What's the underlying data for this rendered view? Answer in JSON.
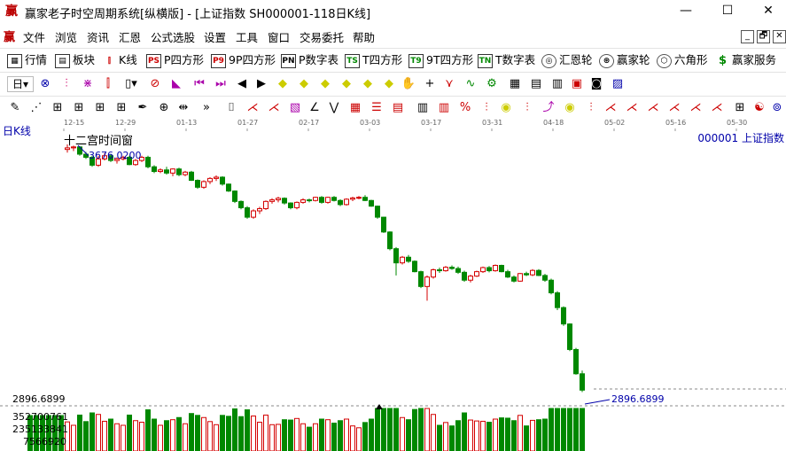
{
  "window": {
    "title": "赢家老子时空周期系统[纵横版] - [上证指数  SH000001-118日K线]",
    "minimize": "—",
    "maximize": "☐",
    "close": "✕"
  },
  "menu": {
    "items": [
      "文件",
      "浏览",
      "资讯",
      "汇恩",
      "公式选股",
      "设置",
      "工具",
      "窗口",
      "交易委托",
      "帮助"
    ],
    "right_buttons": [
      "_",
      "🗗",
      "✕"
    ]
  },
  "toolbar1": [
    {
      "icon": "grid",
      "label": "行情"
    },
    {
      "icon": "blocks",
      "label": "板块"
    },
    {
      "icon": "kline",
      "label": "K线"
    },
    {
      "icon": "PS",
      "label": "P四方形"
    },
    {
      "icon": "P9",
      "label": "9P四方形"
    },
    {
      "icon": "PN",
      "label": "P数字表"
    },
    {
      "icon": "TS",
      "label": "T四方形"
    },
    {
      "icon": "T9",
      "label": "9T四方形"
    },
    {
      "icon": "TN",
      "label": "T数字表"
    },
    {
      "icon": "spiral",
      "label": "汇恩轮"
    },
    {
      "icon": "wheel",
      "label": "赢家轮"
    },
    {
      "icon": "hex",
      "label": "六角形"
    },
    {
      "icon": "dollar",
      "label": "赢家服务"
    }
  ],
  "toolbar2": {
    "period": "日"
  },
  "chart": {
    "panel_label": "日K线",
    "window_label": "十二宫时间窗",
    "code_label": "000001 上证指数",
    "high_label": "3676.0200",
    "low_label": "2896.6899",
    "price_axis_label": "2896.6899",
    "volume_ticks": [
      "352700761",
      "235133841",
      "7566920"
    ],
    "date_labels": [
      "12-15",
      "12-29",
      "01-13",
      "01-27",
      "02-17",
      "03-03",
      "03-17",
      "03-31",
      "04-18",
      "05-02",
      "05-16",
      "05-30"
    ],
    "colors": {
      "up": "#d40000",
      "down": "#008800",
      "label": "#0000aa"
    }
  },
  "chart_data": {
    "type": "candlestick",
    "title": "",
    "ylabel": "",
    "xlabel": "",
    "ohlc": [
      [
        3660,
        3676,
        3650,
        3665
      ],
      [
        3665,
        3672,
        3655,
        3668
      ],
      [
        3668,
        3670,
        3640,
        3645
      ],
      [
        3645,
        3652,
        3630,
        3635
      ],
      [
        3635,
        3640,
        3605,
        3610
      ],
      [
        3610,
        3640,
        3605,
        3630
      ],
      [
        3630,
        3648,
        3625,
        3640
      ],
      [
        3640,
        3645,
        3620,
        3625
      ],
      [
        3625,
        3635,
        3615,
        3630
      ],
      [
        3630,
        3640,
        3625,
        3635
      ],
      [
        3635,
        3640,
        3610,
        3612
      ],
      [
        3612,
        3630,
        3608,
        3625
      ],
      [
        3625,
        3640,
        3620,
        3635
      ],
      [
        3635,
        3640,
        3600,
        3605
      ],
      [
        3605,
        3610,
        3585,
        3590
      ],
      [
        3590,
        3600,
        3585,
        3595
      ],
      [
        3595,
        3605,
        3580,
        3585
      ],
      [
        3585,
        3600,
        3575,
        3598
      ],
      [
        3598,
        3602,
        3575,
        3580
      ],
      [
        3580,
        3592,
        3575,
        3588
      ],
      [
        3588,
        3592,
        3560,
        3562
      ],
      [
        3562,
        3565,
        3535,
        3540
      ],
      [
        3540,
        3562,
        3535,
        3558
      ],
      [
        3558,
        3572,
        3550,
        3568
      ],
      [
        3568,
        3578,
        3560,
        3572
      ],
      [
        3572,
        3575,
        3545,
        3550
      ],
      [
        3550,
        3552,
        3525,
        3528
      ],
      [
        3528,
        3530,
        3490,
        3495
      ],
      [
        3495,
        3498,
        3470,
        3475
      ],
      [
        3475,
        3480,
        3440,
        3445
      ],
      [
        3445,
        3470,
        3440,
        3465
      ],
      [
        3465,
        3478,
        3455,
        3472
      ],
      [
        3472,
        3498,
        3468,
        3495
      ],
      [
        3495,
        3505,
        3488,
        3500
      ],
      [
        3500,
        3510,
        3492,
        3505
      ],
      [
        3505,
        3508,
        3485,
        3490
      ],
      [
        3490,
        3492,
        3470,
        3475
      ],
      [
        3475,
        3495,
        3470,
        3492
      ],
      [
        3492,
        3505,
        3488,
        3500
      ],
      [
        3500,
        3504,
        3492,
        3498
      ],
      [
        3498,
        3510,
        3495,
        3508
      ],
      [
        3508,
        3512,
        3488,
        3492
      ],
      [
        3492,
        3510,
        3488,
        3508
      ],
      [
        3508,
        3512,
        3495,
        3498
      ],
      [
        3498,
        3502,
        3480,
        3485
      ],
      [
        3485,
        3505,
        3482,
        3502
      ],
      [
        3502,
        3510,
        3496,
        3506
      ],
      [
        3506,
        3512,
        3502,
        3508
      ],
      [
        3508,
        3515,
        3496,
        3498
      ],
      [
        3498,
        3500,
        3478,
        3480
      ],
      [
        3480,
        3482,
        3440,
        3445
      ],
      [
        3445,
        3446,
        3395,
        3398
      ],
      [
        3398,
        3400,
        3340,
        3345
      ],
      [
        3345,
        3350,
        3260,
        3300
      ],
      [
        3300,
        3322,
        3295,
        3318
      ],
      [
        3318,
        3325,
        3300,
        3305
      ],
      [
        3305,
        3308,
        3270,
        3272
      ],
      [
        3272,
        3275,
        3220,
        3225
      ],
      [
        3225,
        3260,
        3180,
        3255
      ],
      [
        3255,
        3282,
        3250,
        3278
      ],
      [
        3278,
        3285,
        3268,
        3275
      ],
      [
        3275,
        3290,
        3272,
        3286
      ],
      [
        3286,
        3292,
        3278,
        3282
      ],
      [
        3282,
        3288,
        3265,
        3270
      ],
      [
        3270,
        3275,
        3240,
        3245
      ],
      [
        3245,
        3262,
        3238,
        3258
      ],
      [
        3258,
        3275,
        3255,
        3272
      ],
      [
        3272,
        3288,
        3268,
        3285
      ],
      [
        3285,
        3290,
        3270,
        3275
      ],
      [
        3275,
        3295,
        3272,
        3292
      ],
      [
        3292,
        3294,
        3270,
        3272
      ],
      [
        3272,
        3278,
        3252,
        3255
      ],
      [
        3255,
        3260,
        3238,
        3242
      ],
      [
        3242,
        3268,
        3240,
        3266
      ],
      [
        3266,
        3272,
        3258,
        3262
      ],
      [
        3262,
        3280,
        3258,
        3276
      ],
      [
        3276,
        3280,
        3258,
        3260
      ],
      [
        3260,
        3265,
        3240,
        3245
      ],
      [
        3245,
        3250,
        3200,
        3205
      ],
      [
        3205,
        3210,
        3150,
        3158
      ],
      [
        3158,
        3162,
        3100,
        3106
      ],
      [
        3106,
        3108,
        3020,
        3025
      ],
      [
        3025,
        3030,
        2945,
        2948
      ],
      [
        2948,
        2958,
        2890,
        2896
      ]
    ],
    "volume_upper": 352700761,
    "volume_mid": 235133841,
    "volume_low": 7566920
  }
}
